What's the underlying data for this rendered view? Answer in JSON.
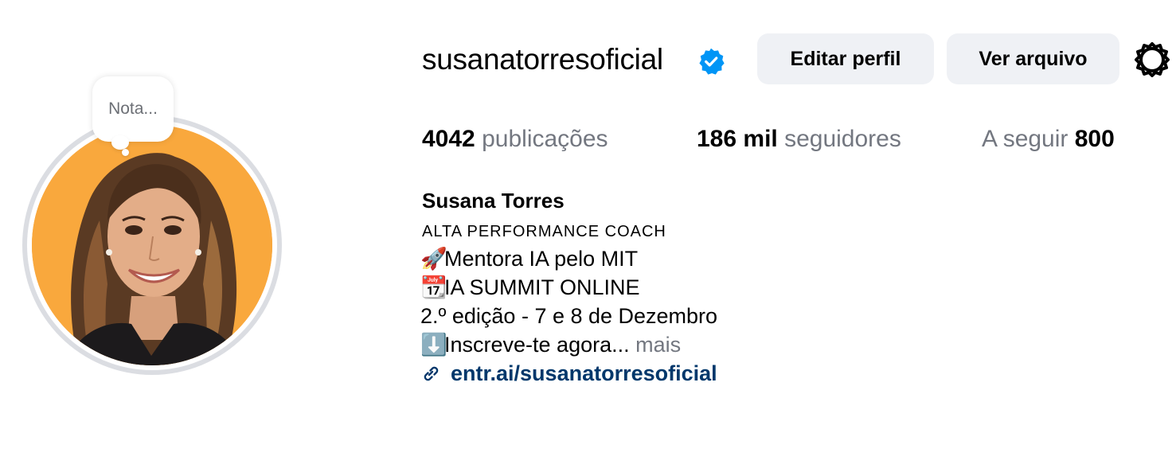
{
  "profile": {
    "username": "susanatorresoficial",
    "verified_icon": "verified-badge-icon",
    "note_placeholder": "Nota...",
    "buttons": {
      "edit": "Editar perfil",
      "archive": "Ver arquivo"
    },
    "settings_icon": "gear-icon"
  },
  "stats": {
    "posts_count": "4042",
    "posts_label": "publicações",
    "followers_count": "186 mil",
    "followers_label": "seguidores",
    "following_label": "A seguir",
    "following_count": "800"
  },
  "bio": {
    "full_name": "Susana Torres",
    "category": "ALTA PERFORMANCE COACH",
    "lines": [
      {
        "emoji": "🚀",
        "text": "Mentora IA pelo MIT"
      },
      {
        "emoji": "📆",
        "text": "IA SUMMIT ONLINE"
      },
      {
        "emoji": "",
        "text": "2.º edição - 7 e 8 de Dezembro"
      },
      {
        "emoji": "⬇️",
        "text": "Inscreve-te agora..."
      }
    ],
    "more_label": "mais",
    "link_text": "entr.ai/susanatorresoficial",
    "link_icon": "link-icon"
  },
  "colors": {
    "verified_blue": "#0095f6",
    "link_blue": "#00376b",
    "button_bg": "#eff1f5",
    "muted_text": "#737780",
    "avatar_bg": "#f9a83d"
  }
}
